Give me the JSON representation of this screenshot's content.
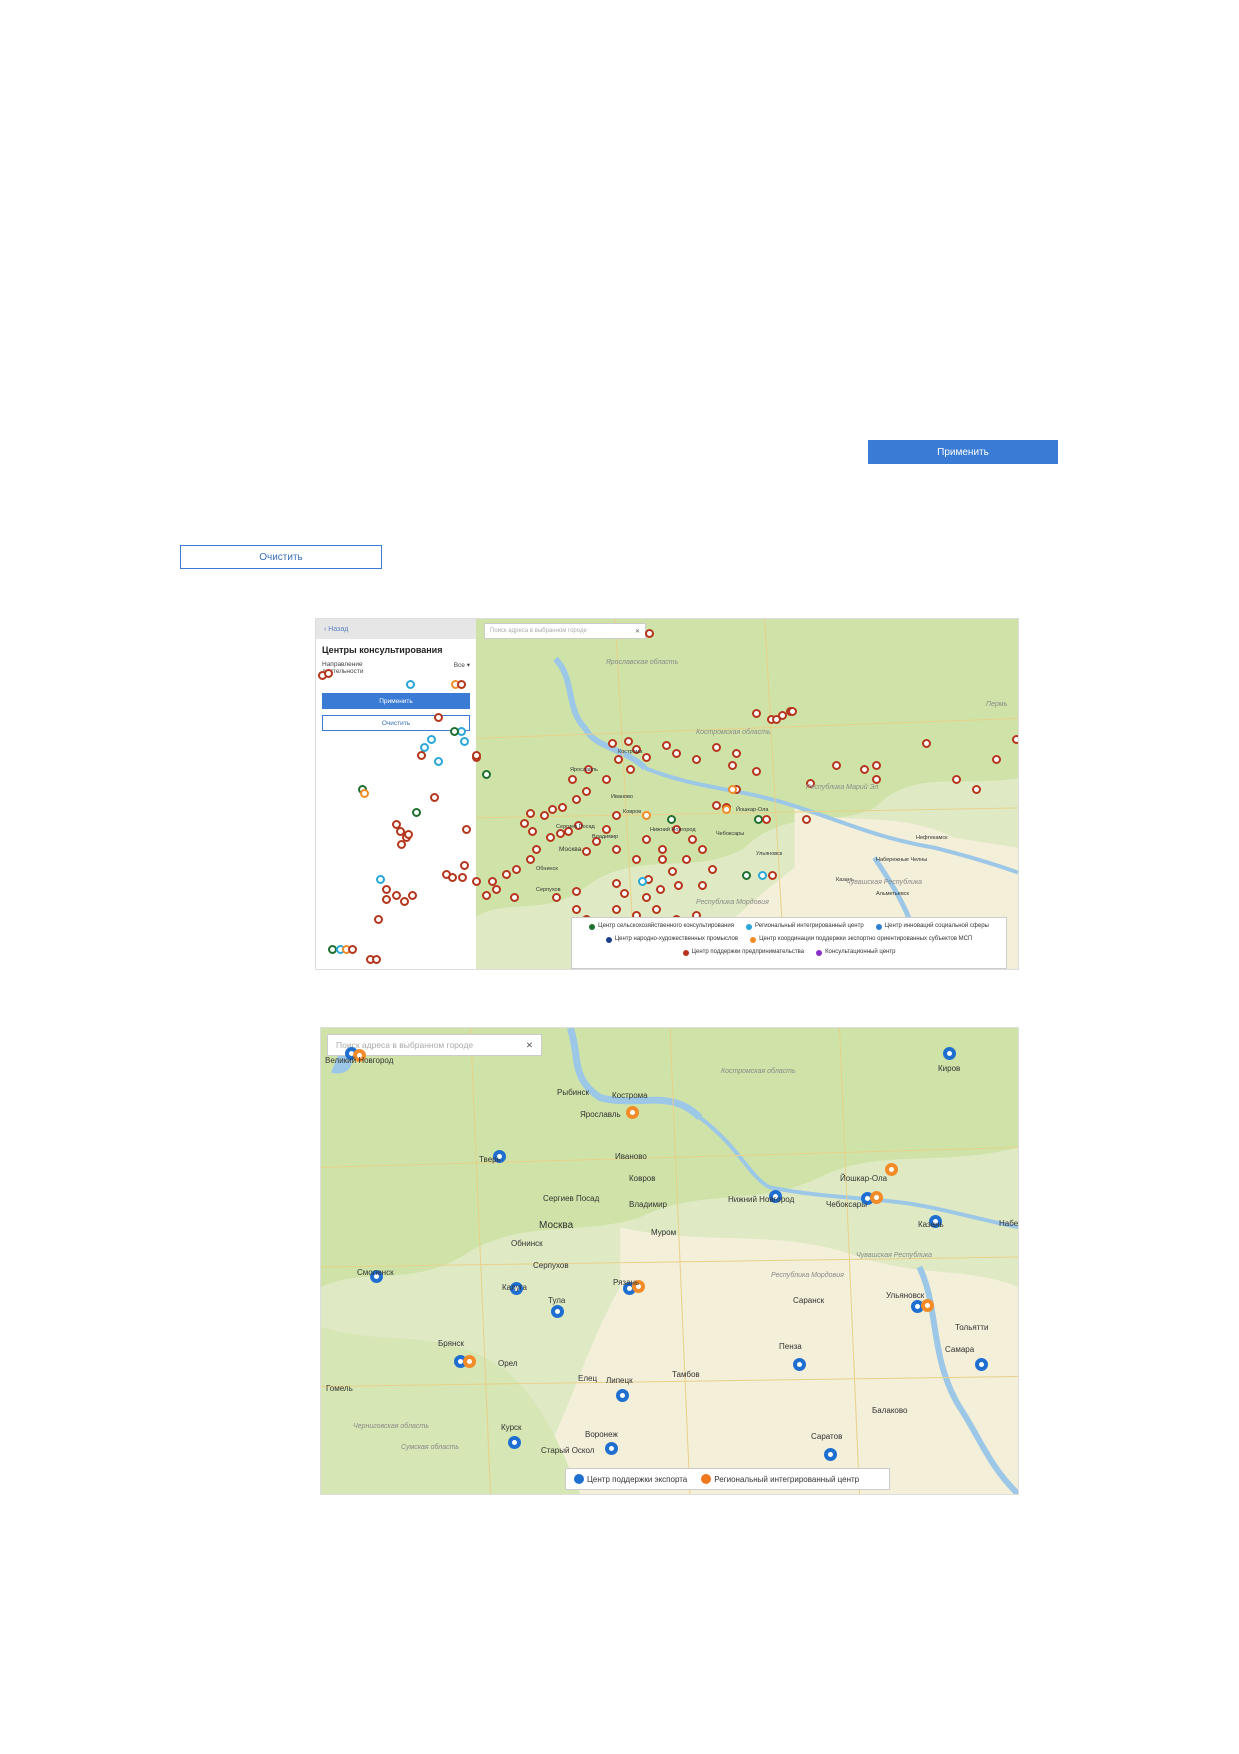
{
  "top_controls": {
    "apply_label": "Применить",
    "clear_label": "Очистить"
  },
  "screenshot1": {
    "back_label": "Назад",
    "panel_title": "Центры консультирования",
    "filter_label": "Направление деятельности",
    "filter_value": "Все",
    "apply_label": "Применить",
    "clear_label": "Очистить",
    "search_placeholder": "Поиск адреса в выбранном городе",
    "cities": [
      "Ярославль",
      "Иваново",
      "Кострома",
      "Ковров",
      "Сергиев Посад",
      "Владимир",
      "Москва",
      "Обнинск",
      "Серпухов",
      "Нижний Новгород",
      "Чебоксары",
      "Йошкар-Ола",
      "Ульяновск",
      "Казань",
      "Набережные Челны",
      "Нефтекамск",
      "Альметьевск"
    ],
    "regions": [
      "Ярославская область",
      "Костромская область",
      "Республика Марий Эл",
      "Чувашская Республика",
      "Республика Мордовия",
      "Пермь"
    ],
    "legend": [
      {
        "label": "Центр сельскохозяйственного консультирования",
        "color": "#1f6f2e"
      },
      {
        "label": "Региональный интегрированный центр",
        "color": "#2aa7d9"
      },
      {
        "label": "Центр инноваций социальной сферы",
        "color": "#2f7fd4"
      },
      {
        "label": "Центр народно-художественных промыслов",
        "color": "#1c3f8a"
      },
      {
        "label": "Центр координации поддержки экспортно ориентированных субъектов МСП",
        "color": "#f28c28"
      },
      {
        "label": "Центр поддержки предпринимательства",
        "color": "#b5361d"
      },
      {
        "label": "Консультационный центр",
        "color": "#8b2fc9"
      }
    ]
  },
  "screenshot2": {
    "search_placeholder": "Поиск адреса в выбранном городе",
    "cities": [
      "Великий Новгород",
      "Рыбинск",
      "Кострома",
      "Ярославль",
      "Тверь",
      "Иваново",
      "Ковров",
      "Сергиев Посад",
      "Владимир",
      "Нижний Новгород",
      "Йошкар-Ола",
      "Чебоксары",
      "Казань",
      "Москва",
      "Муром",
      "Обнинск",
      "Серпухов",
      "Смоленск",
      "Калуга",
      "Рязань",
      "Тула",
      "Саранск",
      "Ульяновск",
      "Тольятти",
      "Брянск",
      "Орел",
      "Пенза",
      "Самара",
      "Елец",
      "Липецк",
      "Тамбов",
      "Гомель",
      "Курск",
      "Воронеж",
      "Балаково",
      "Саратов",
      "Старый Оскол",
      "Киров",
      "Набережные Челны"
    ],
    "regions": [
      "Костромская область",
      "Чувашская Республика",
      "Республика Мордовия",
      "Черниговская область",
      "Сумская область"
    ],
    "legend": [
      {
        "label": "Центр поддержки экспорта",
        "color": "#1f6fd1"
      },
      {
        "label": "Региональный интегрированный центр",
        "color": "#f0781e"
      }
    ]
  },
  "colors": {
    "accent": "#3a7bd5",
    "map_green": "#cfe3a8",
    "map_light": "#f3efd9"
  }
}
